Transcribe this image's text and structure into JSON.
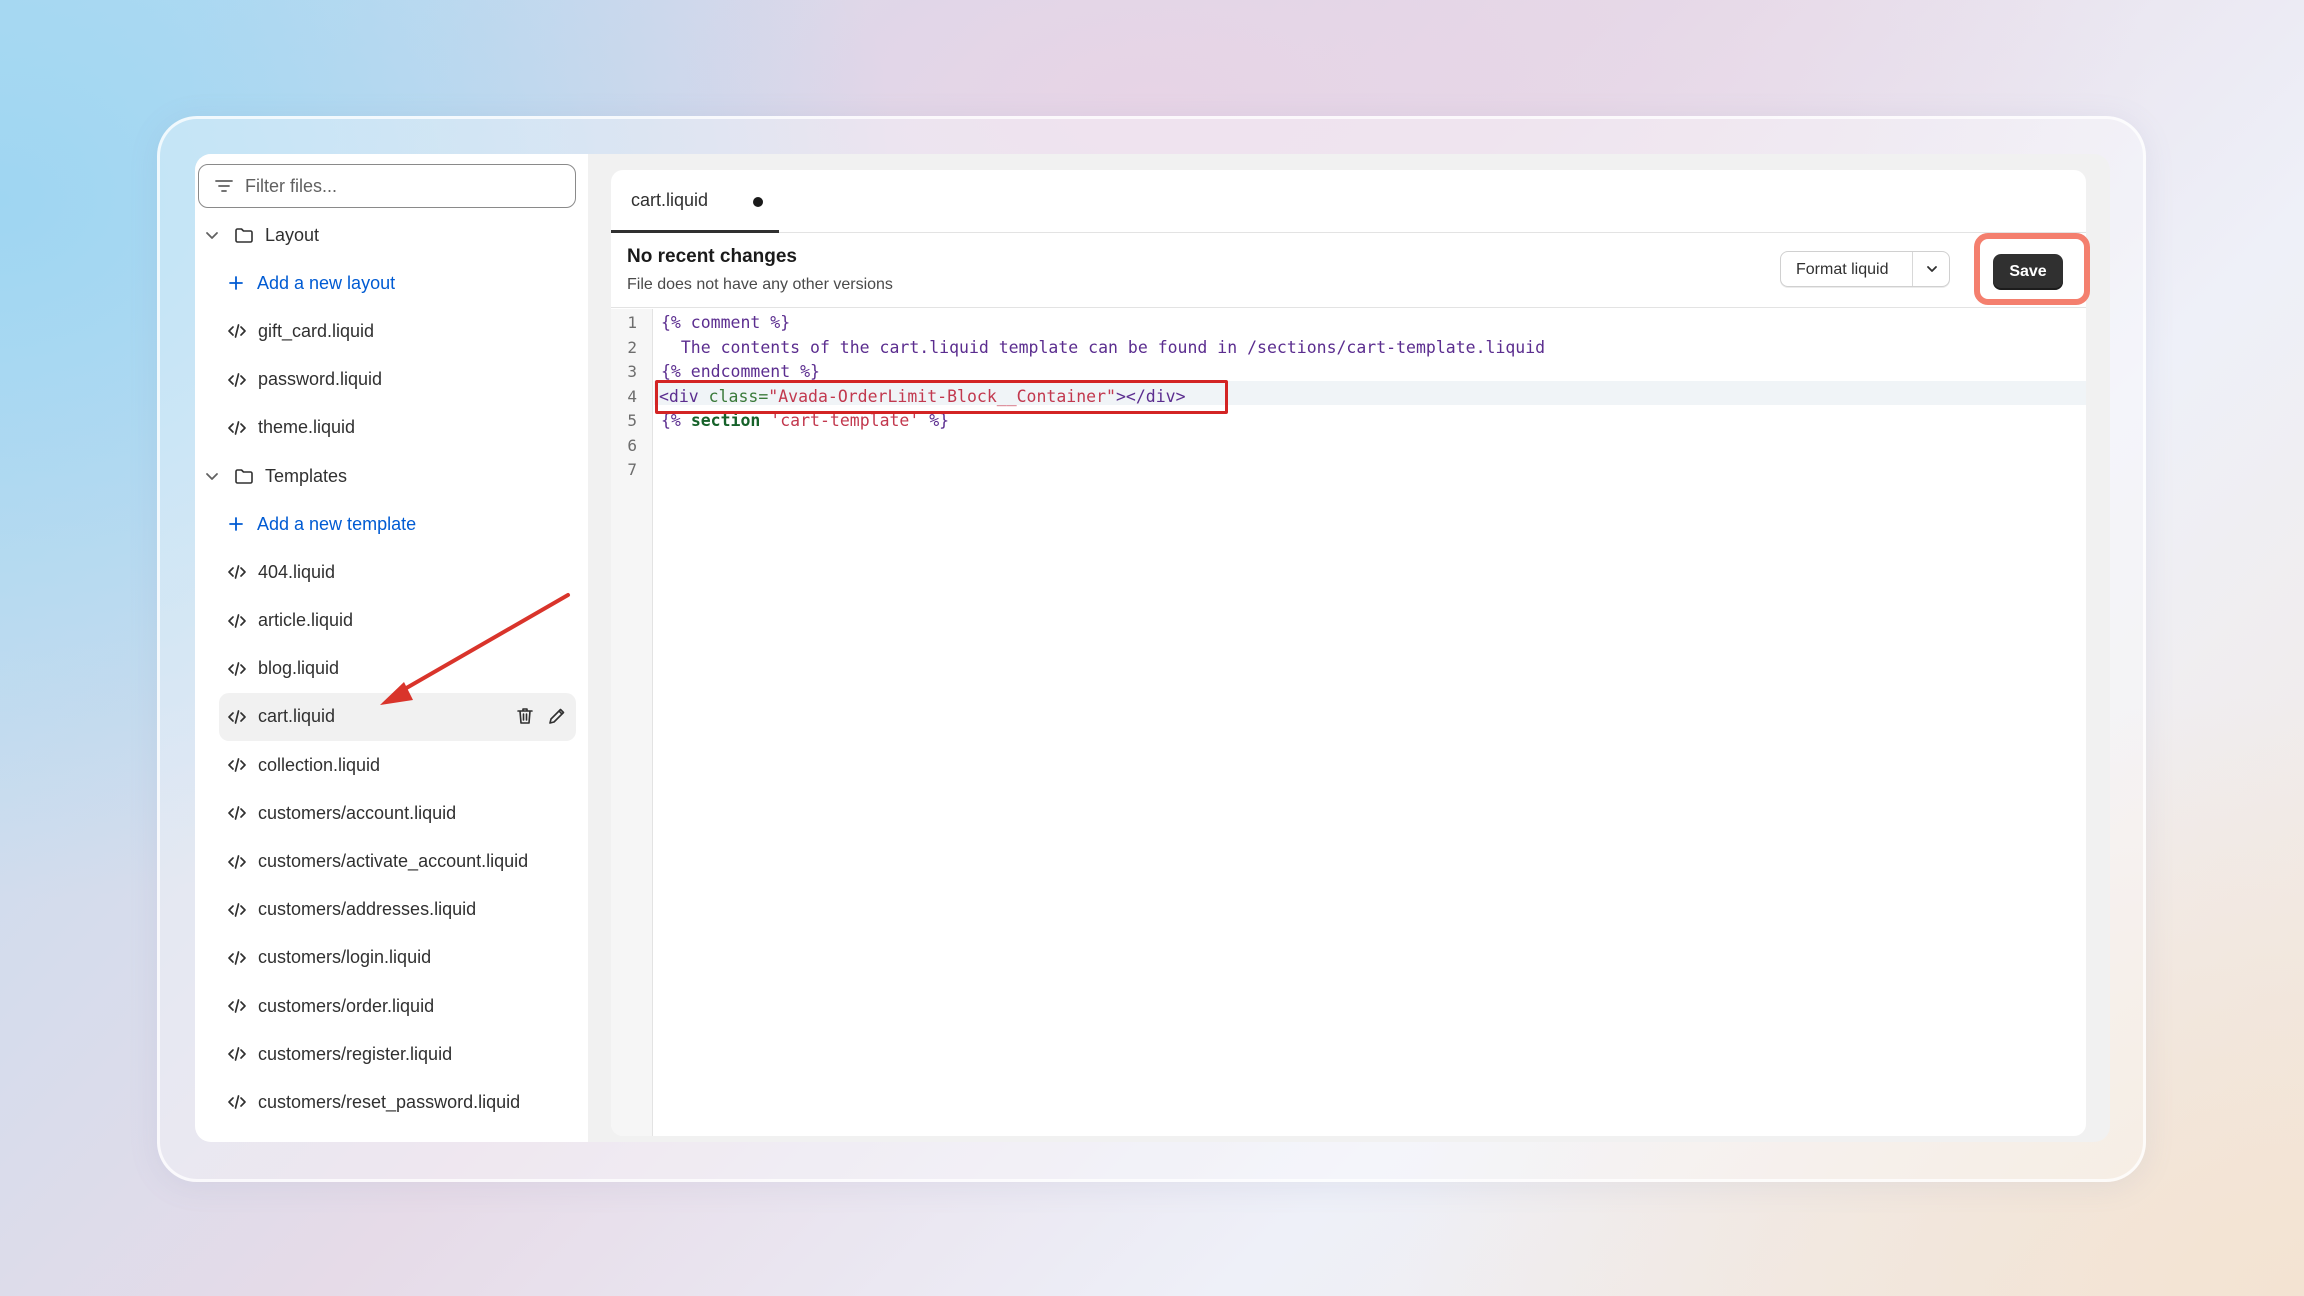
{
  "sidebar": {
    "filter_placeholder": "Filter files...",
    "layout_folder": "Layout",
    "add_layout": "Add a new layout",
    "layout_files": [
      "gift_card.liquid",
      "password.liquid",
      "theme.liquid"
    ],
    "templates_folder": "Templates",
    "add_template": "Add a new template",
    "template_files": [
      "404.liquid",
      "article.liquid",
      "blog.liquid",
      "cart.liquid",
      "collection.liquid",
      "customers/account.liquid",
      "customers/activate_account.liquid",
      "customers/addresses.liquid",
      "customers/login.liquid",
      "customers/order.liquid",
      "customers/register.liquid",
      "customers/reset_password.liquid"
    ],
    "selected_file": "cart.liquid"
  },
  "editor": {
    "tab_label": "cart.liquid",
    "info_title": "No recent changes",
    "info_subtitle": "File does not have any other versions",
    "format_label": "Format liquid",
    "save_label": "Save",
    "line_numbers": [
      "1",
      "2",
      "3",
      "4",
      "5",
      "6",
      "7"
    ],
    "code": {
      "l1": "{% comment %}",
      "l2": "  The contents of the cart.liquid template can be found in /sections/cart-template.liquid",
      "l3": "{% endcomment %}",
      "l4_tag_open": "<div ",
      "l4_attr": "class=",
      "l4_value": "\"Avada-OrderLimit-Block__Container\"",
      "l4_tag_close": "></div>",
      "l5_open": "{% ",
      "l5_kw": "section",
      "l5_str": " 'cart-template'",
      "l5_close": " %}"
    }
  },
  "colors": {
    "highlight_box": "#d32424",
    "save_highlight": "#f47f6e",
    "arrow": "#d9342b",
    "link": "#005bd3"
  }
}
